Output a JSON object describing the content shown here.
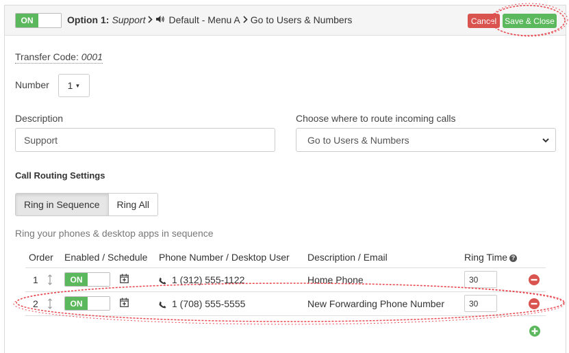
{
  "header": {
    "toggle_on_label": "ON",
    "option_prefix": "Option 1:",
    "option_name": "Support",
    "menu_name": "Default - Menu A",
    "route_target": "Go to Users & Numbers",
    "cancel_label": "Cancel",
    "save_close_label": "Save & Close"
  },
  "transfer_code": {
    "label": "Transfer Code:",
    "value": "0001"
  },
  "number": {
    "label": "Number",
    "value": "1"
  },
  "description": {
    "label": "Description",
    "value": "Support"
  },
  "routing": {
    "label": "Choose where to route incoming calls",
    "selected": "Go to Users & Numbers"
  },
  "call_routing": {
    "title": "Call Routing Settings",
    "modes": [
      "Ring in Sequence",
      "Ring All"
    ],
    "active_mode": "Ring in Sequence",
    "hint": "Ring your phones & desktop apps in sequence"
  },
  "table": {
    "columns": [
      "Order",
      "Enabled / Schedule",
      "Phone Number / Desktop User",
      "Description / Email",
      "Ring Time"
    ],
    "rows": [
      {
        "order": "1",
        "enabled": "ON",
        "phone": "1 (312) 555-1122",
        "description": "Home Phone",
        "ring_time": "30"
      },
      {
        "order": "2",
        "enabled": "ON",
        "phone": "1 (708) 555-5555",
        "description": "New Forwarding Phone Number",
        "ring_time": "30"
      }
    ]
  },
  "colors": {
    "green": "#5cb85c",
    "red": "#d9534f",
    "annotation": "#e8474f"
  },
  "icons": [
    "speaker-icon",
    "chevron-right-icon",
    "caret-down-icon",
    "drag-handle-icon",
    "calendar-add-icon",
    "phone-icon",
    "help-icon",
    "remove-icon",
    "add-icon"
  ]
}
